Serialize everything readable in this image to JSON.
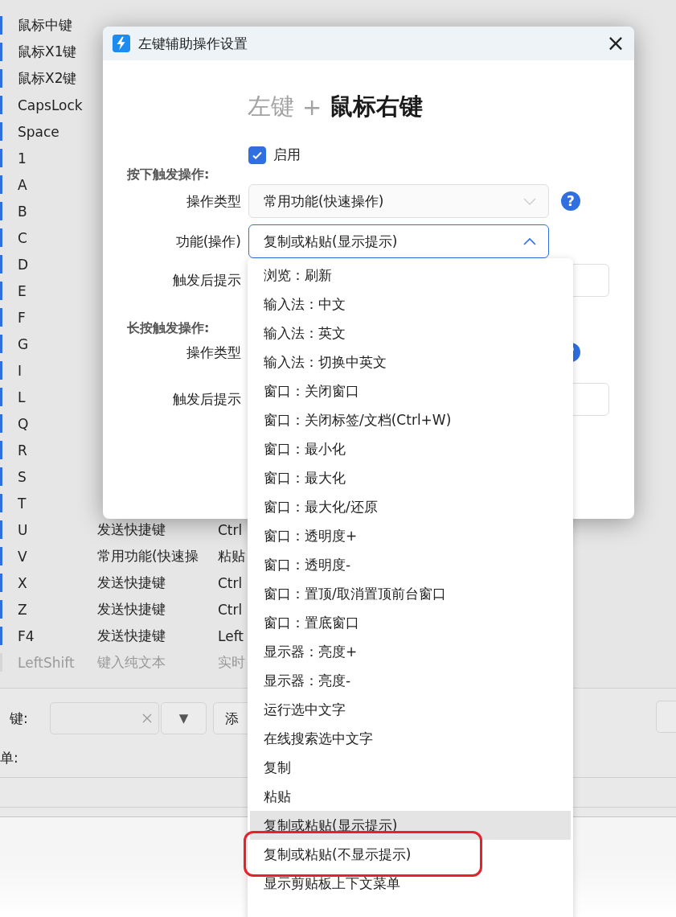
{
  "background_table": {
    "rows": [
      {
        "key": "鼠标中键",
        "enabled": true,
        "cells": []
      },
      {
        "key": "鼠标X1键",
        "enabled": true,
        "cells": []
      },
      {
        "key": "鼠标X2键",
        "enabled": true,
        "cells": []
      },
      {
        "key": "CapsLock",
        "enabled": true,
        "cells": []
      },
      {
        "key": "Space",
        "enabled": true,
        "cells": []
      },
      {
        "key": "1",
        "enabled": true,
        "cells": []
      },
      {
        "key": "A",
        "enabled": true,
        "cells": []
      },
      {
        "key": "B",
        "enabled": true,
        "cells": []
      },
      {
        "key": "C",
        "enabled": true,
        "cells": []
      },
      {
        "key": "D",
        "enabled": true,
        "cells": []
      },
      {
        "key": "E",
        "enabled": true,
        "cells": []
      },
      {
        "key": "F",
        "enabled": true,
        "cells": []
      },
      {
        "key": "G",
        "enabled": true,
        "cells": []
      },
      {
        "key": "I",
        "enabled": true,
        "cells": []
      },
      {
        "key": "L",
        "enabled": true,
        "cells": []
      },
      {
        "key": "Q",
        "enabled": true,
        "cells": []
      },
      {
        "key": "R",
        "enabled": true,
        "cells": []
      },
      {
        "key": "S",
        "enabled": true,
        "cells": []
      },
      {
        "key": "T",
        "enabled": true,
        "cells": []
      },
      {
        "key": "U",
        "enabled": true,
        "cells": [
          "发送快捷键",
          "Ctrl"
        ]
      },
      {
        "key": "V",
        "enabled": true,
        "cells": [
          "常用功能(快速操",
          "粘贴"
        ]
      },
      {
        "key": "X",
        "enabled": true,
        "cells": [
          "发送快捷键",
          "Ctrl"
        ]
      },
      {
        "key": "Z",
        "enabled": true,
        "cells": [
          "发送快捷键",
          "Ctrl"
        ]
      },
      {
        "key": "F4",
        "enabled": true,
        "cells": [
          "发送快捷键",
          "Left"
        ]
      },
      {
        "key": "LeftShift",
        "enabled": false,
        "cells": [
          "键入纯文本",
          "实时"
        ]
      }
    ]
  },
  "bottom_panel": {
    "key_label": "键:",
    "dropdown_arrow": "▼",
    "add_button": "添",
    "list_label": "单:"
  },
  "dialog": {
    "title": "左键辅助操作设置",
    "close": "×",
    "heading": {
      "modifier": "左键",
      "plus": "+",
      "key": "鼠标右键"
    },
    "enabled": {
      "label": "启用",
      "checked": true
    },
    "press_section": {
      "title": "按下触发操作:",
      "operation_type": {
        "label": "操作类型",
        "value": "常用功能(快速操作)",
        "help": "?"
      },
      "function": {
        "label": "功能(操作)",
        "value": "复制或粘贴(显示提示)",
        "expanded": true
      },
      "hint": {
        "label": "触发后提示"
      }
    },
    "long_press_section": {
      "title": "长按触发操作:",
      "operation_type": {
        "label": "操作类型"
      },
      "hint": {
        "label": "触发后提示"
      }
    }
  },
  "dropdown": {
    "items": [
      {
        "label": "浏览：刷新",
        "selected": false
      },
      {
        "label": "输入法：中文",
        "selected": false
      },
      {
        "label": "输入法：英文",
        "selected": false
      },
      {
        "label": "输入法：切换中英文",
        "selected": false
      },
      {
        "label": "窗口：关闭窗口",
        "selected": false
      },
      {
        "label": "窗口：关闭标签/文档(Ctrl+W)",
        "selected": false
      },
      {
        "label": "窗口：最小化",
        "selected": false
      },
      {
        "label": "窗口：最大化",
        "selected": false
      },
      {
        "label": "窗口：最大化/还原",
        "selected": false
      },
      {
        "label": "窗口：透明度+",
        "selected": false
      },
      {
        "label": "窗口：透明度-",
        "selected": false
      },
      {
        "label": "窗口：置顶/取消置顶前台窗口",
        "selected": false
      },
      {
        "label": "窗口：置底窗口",
        "selected": false
      },
      {
        "label": "显示器：亮度+",
        "selected": false
      },
      {
        "label": "显示器：亮度-",
        "selected": false
      },
      {
        "label": "运行选中文字",
        "selected": false
      },
      {
        "label": "在线搜索选中文字",
        "selected": false
      },
      {
        "label": "复制",
        "selected": false
      },
      {
        "label": "粘贴",
        "selected": false
      },
      {
        "label": "复制或粘贴(显示提示)",
        "selected": true
      },
      {
        "label": "复制或粘贴(不显示提示)",
        "selected": false
      },
      {
        "label": "显示剪贴板上下文菜单",
        "selected": false
      }
    ]
  },
  "annotation": {
    "kind": "highlight"
  }
}
